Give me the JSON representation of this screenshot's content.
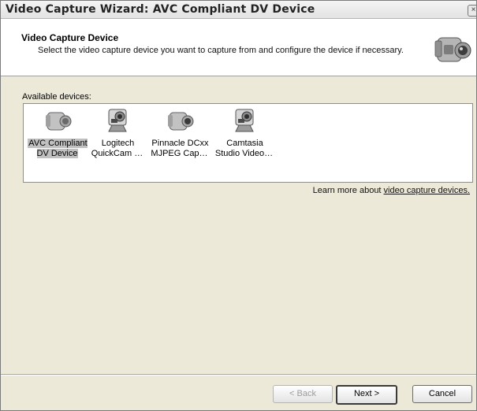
{
  "window": {
    "title": "Video Capture Wizard: AVC Compliant DV Device",
    "close_glyph": "×"
  },
  "header": {
    "title": "Video Capture Device",
    "description": "Select the video capture device you want to capture from and configure the device if necessary.",
    "icon": "camcorder-icon"
  },
  "devices": {
    "label": "Available devices:",
    "items": [
      {
        "label": "AVC Compliant\nDV Device",
        "icon": "camcorder-icon",
        "selected": true
      },
      {
        "label": "Logitech\nQuickCam …",
        "icon": "webcam-icon",
        "selected": false
      },
      {
        "label": "Pinnacle DCxx\nMJPEG Cap…",
        "icon": "camcorder-icon",
        "selected": false
      },
      {
        "label": "Camtasia\nStudio Video…",
        "icon": "webcam-icon",
        "selected": false
      }
    ]
  },
  "learn_more": {
    "prefix": "Learn more about ",
    "link": "video capture devices."
  },
  "buttons": {
    "back": "< Back",
    "next": "Next >",
    "cancel": "Cancel",
    "back_enabled": false
  }
}
